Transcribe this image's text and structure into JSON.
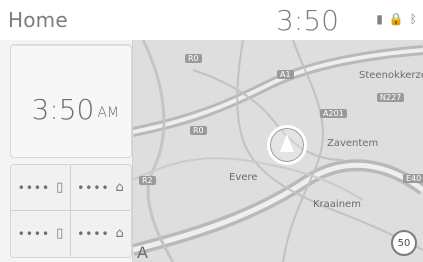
{
  "header": {
    "title": "Home",
    "time": "3:50",
    "status_icons": [
      "signal-icon",
      "lock-icon",
      "bluetooth-icon"
    ]
  },
  "clock_card": {
    "time": "3:50",
    "ampm": "AM"
  },
  "shortcuts": [
    {
      "dots": "••••",
      "icon": "phone-icon"
    },
    {
      "dots": "••••",
      "icon": "home-icon"
    },
    {
      "dots": "••••",
      "icon": "phone-icon"
    },
    {
      "dots": "••••",
      "icon": "home-icon"
    }
  ],
  "map": {
    "places": [
      "Steenokkerzeel",
      "Zaventem",
      "Evere",
      "Kraainem"
    ],
    "roads": [
      "R0",
      "A1",
      "A201",
      "N227",
      "R0",
      "R2",
      "E40"
    ],
    "speed_limit": "50",
    "bottom_letter": "A"
  }
}
